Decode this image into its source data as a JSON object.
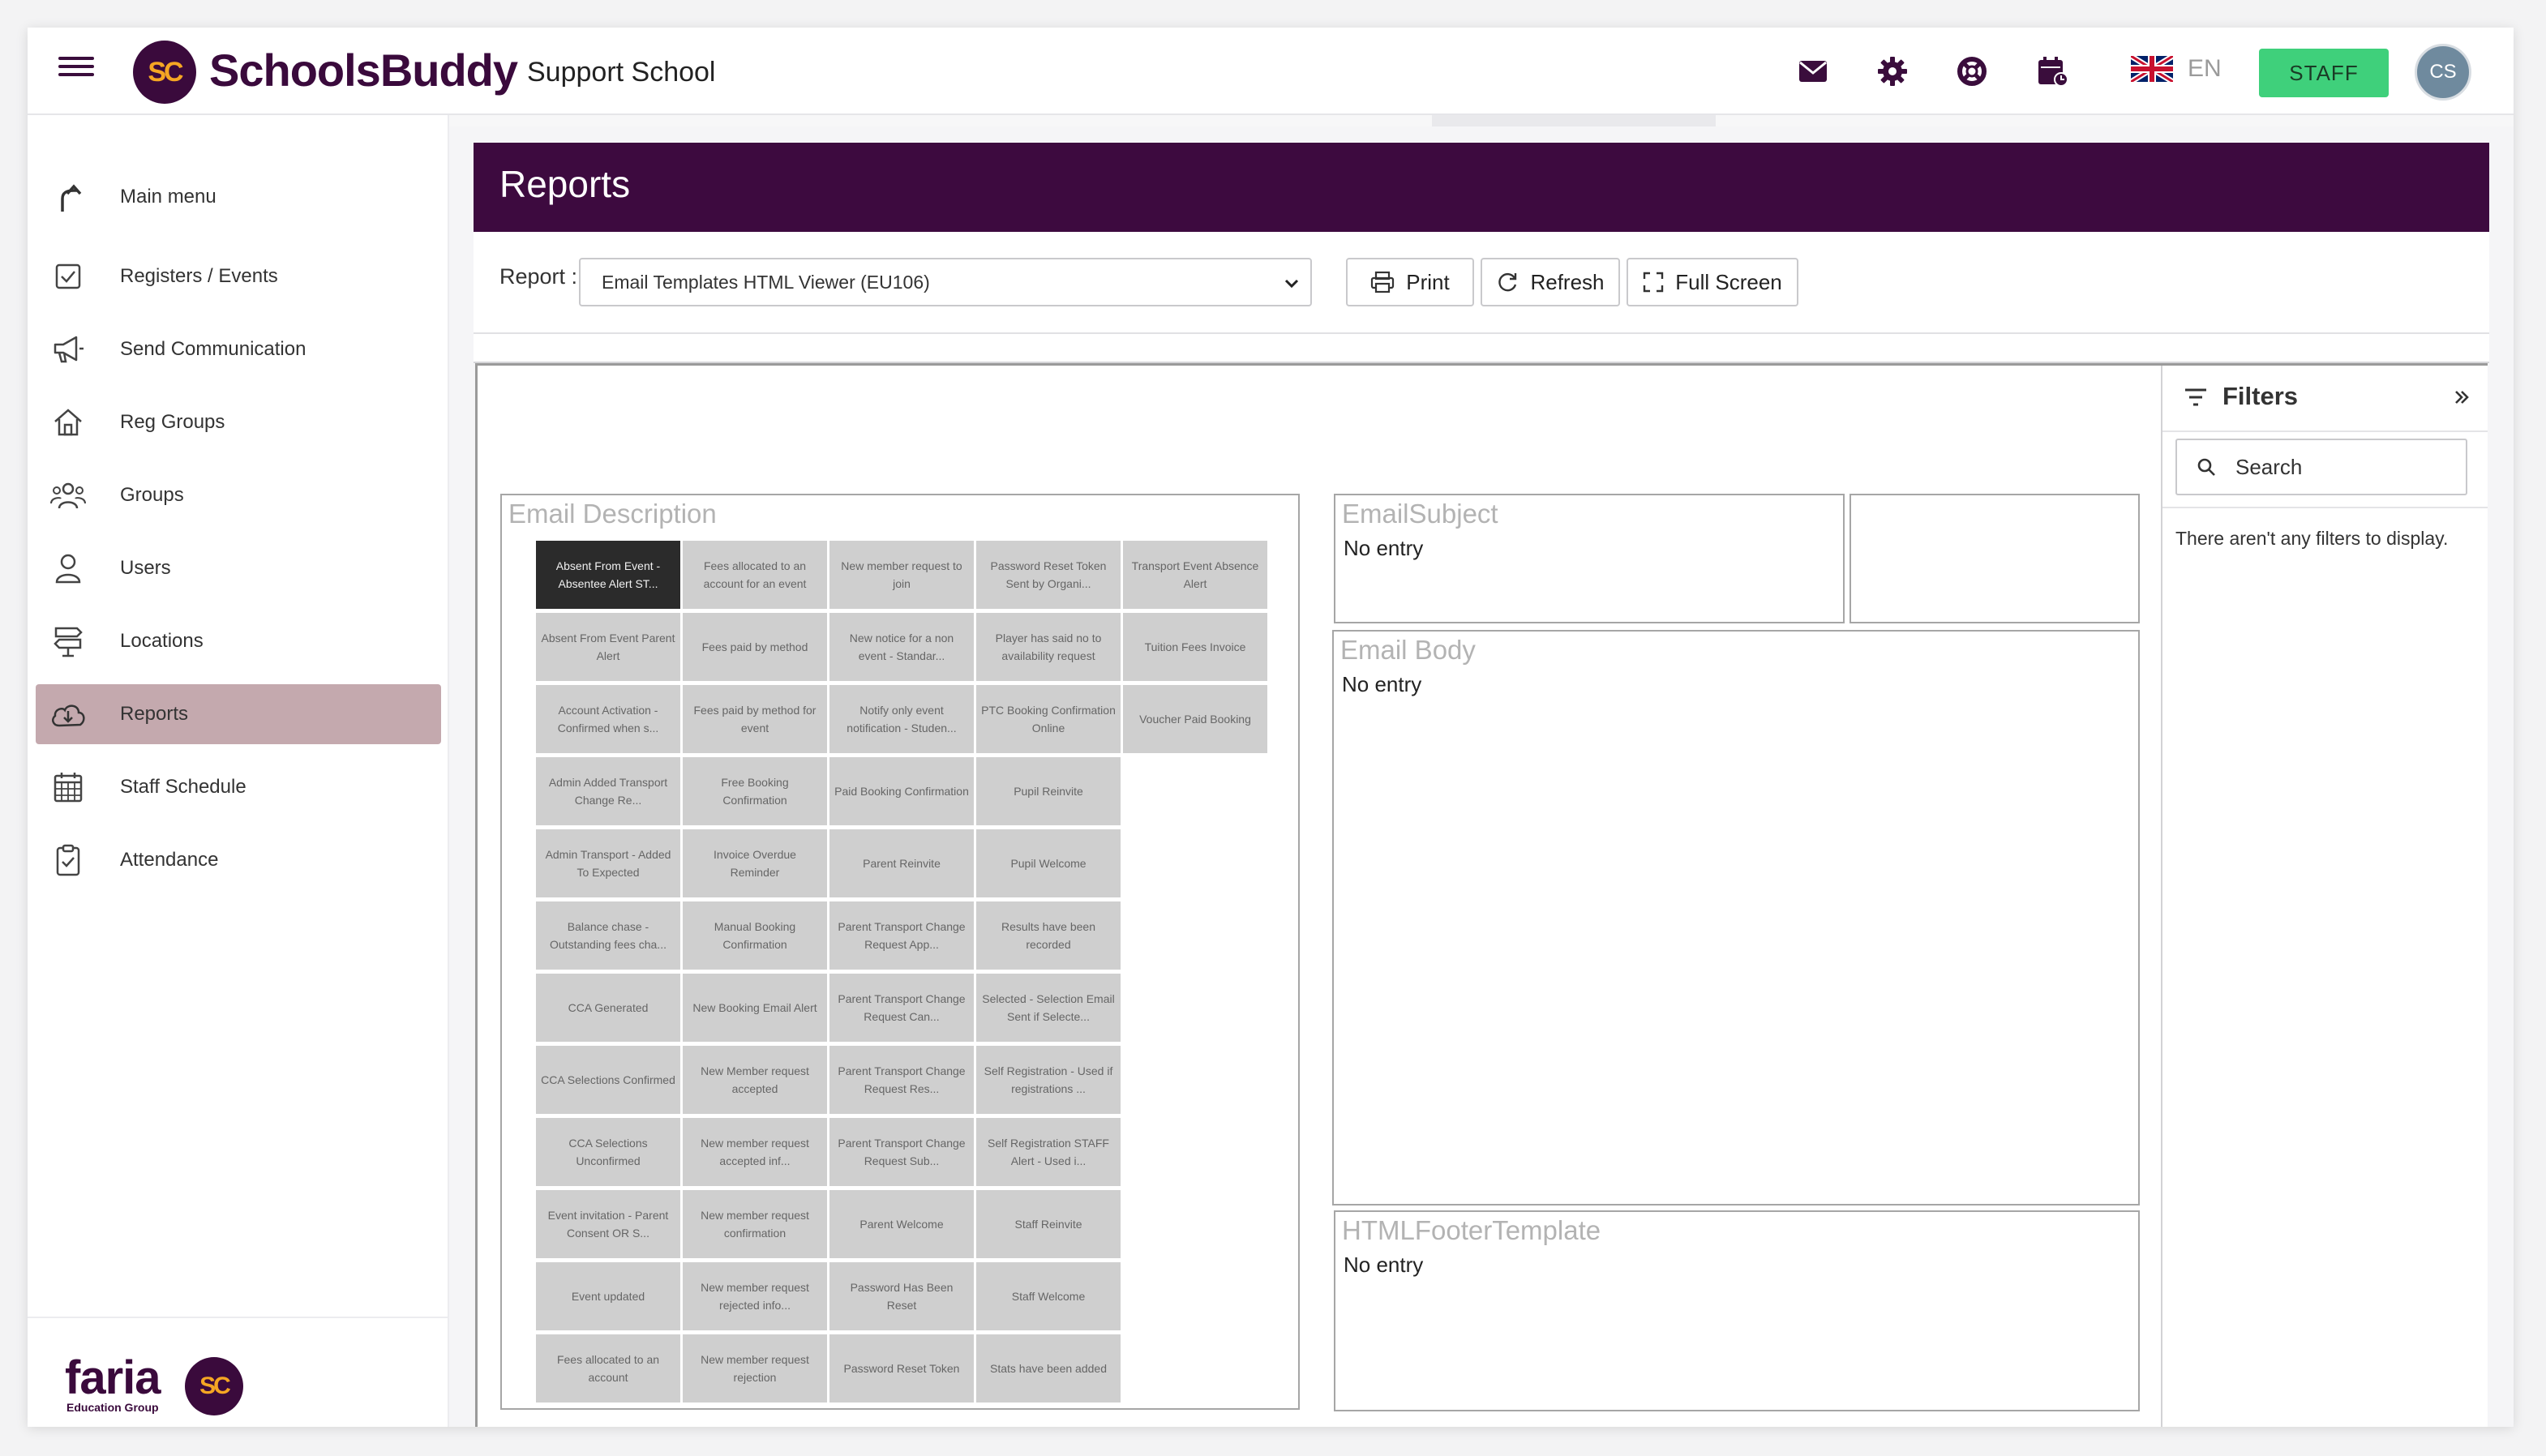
{
  "header": {
    "brand": "SchoolsBuddy",
    "logo_initials": "SC",
    "school_name": "Support School",
    "icons": [
      "envelope-icon",
      "gear-icon",
      "lifebuoy-icon",
      "calendar-clock-icon"
    ],
    "language_code": "EN",
    "role_button": "STAFF",
    "avatar_initials": "CS",
    "colors": {
      "brand_purple": "#3d0a3f",
      "staff_green": "#3fd07b",
      "logo_orange": "#f5a623"
    }
  },
  "sidebar": {
    "items": [
      {
        "label": "Main menu",
        "icon": "back-arrow-icon"
      },
      {
        "label": "Registers / Events",
        "icon": "checkbox-icon"
      },
      {
        "label": "Send Communication",
        "icon": "megaphone-icon"
      },
      {
        "label": "Reg Groups",
        "icon": "home-icon"
      },
      {
        "label": "Groups",
        "icon": "people-icon"
      },
      {
        "label": "Users",
        "icon": "user-icon"
      },
      {
        "label": "Locations",
        "icon": "signpost-icon"
      },
      {
        "label": "Reports",
        "icon": "cloud-download-icon",
        "active": true
      },
      {
        "label": "Staff Schedule",
        "icon": "calendar-grid-icon"
      },
      {
        "label": "Attendance",
        "icon": "clipboard-check-icon"
      }
    ],
    "footer": {
      "company": "faria",
      "company_sub": "Education Group",
      "logo_initials": "SC"
    }
  },
  "page": {
    "title": "Reports",
    "report_label": "Report :",
    "report_selected": "Email Templates HTML Viewer (EU106)",
    "buttons": {
      "print": "Print",
      "refresh": "Refresh",
      "fullscreen": "Full Screen"
    }
  },
  "report": {
    "email_description_title": "Email Description",
    "tiles": [
      [
        "Absent From Event - Absentee Alert ST...",
        "Fees allocated to an account for an event",
        "New member request to join",
        "Password Reset Token Sent by Organi...",
        "Transport Event Absence Alert"
      ],
      [
        "Absent From Event Parent Alert",
        "Fees paid by method",
        "New notice for a non event - Standar...",
        "Player has said no to availability request",
        "Tuition Fees Invoice"
      ],
      [
        "Account Activation - Confirmed when s...",
        "Fees paid by method for event",
        "Notify only event notification - Studen...",
        "PTC Booking Confirmation Online",
        "Voucher Paid Booking"
      ],
      [
        "Admin Added Transport Change Re...",
        "Free Booking Confirmation",
        "Paid Booking Confirmation",
        "Pupil Reinvite"
      ],
      [
        "Admin Transport - Added To Expected",
        "Invoice Overdue Reminder",
        "Parent Reinvite",
        "Pupil Welcome"
      ],
      [
        "Balance chase - Outstanding fees cha...",
        "Manual Booking Confirmation",
        "Parent Transport Change Request App...",
        "Results have been recorded"
      ],
      [
        "CCA Generated",
        "New Booking Email Alert",
        "Parent Transport Change Request Can...",
        "Selected - Selection Email Sent if Selecte..."
      ],
      [
        "CCA Selections Confirmed",
        "New Member request accepted",
        "Parent Transport Change Request Res...",
        "Self Registration - Used if registrations ..."
      ],
      [
        "CCA Selections Unconfirmed",
        "New member request accepted inf...",
        "Parent Transport Change Request Sub...",
        "Self Registration STAFF Alert - Used i..."
      ],
      [
        "Event invitation - Parent Consent OR S...",
        "New member request confirmation",
        "Parent Welcome",
        "Staff Reinvite"
      ],
      [
        "Event updated",
        "New member request rejected info...",
        "Password Has Been Reset",
        "Staff Welcome"
      ],
      [
        "Fees allocated to an account",
        "New member request rejection",
        "Password Reset Token",
        "Stats have been added"
      ]
    ],
    "email_subject": {
      "title": "EmailSubject",
      "value": "No entry"
    },
    "email_body": {
      "title": "Email Body",
      "value": "No entry"
    },
    "html_footer": {
      "title": "HTMLFooterTemplate",
      "value": "No entry"
    }
  },
  "filters": {
    "title": "Filters",
    "search_placeholder": "Search",
    "empty_message": "There aren't any filters to display."
  }
}
